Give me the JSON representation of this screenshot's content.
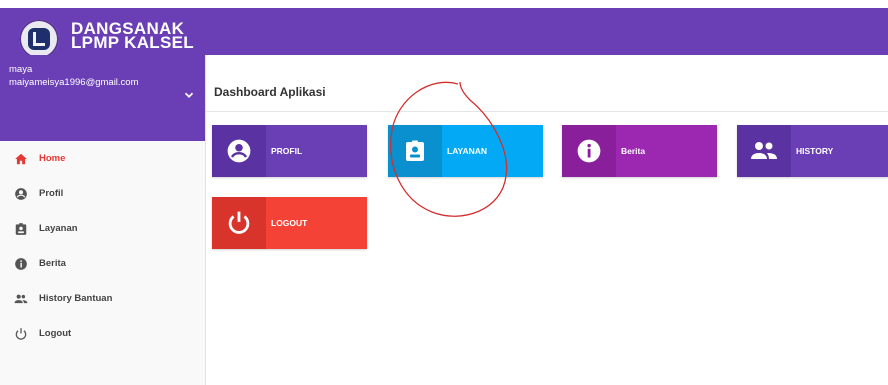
{
  "app": {
    "brand_line1": "DANGSANAK",
    "brand_line2": "LPMP KALSEL"
  },
  "user": {
    "name": "maya",
    "email": "maiyameisya1996@gmail.com"
  },
  "sidebar": {
    "items": [
      {
        "label": "Home",
        "icon": "home-icon",
        "active": true
      },
      {
        "label": "Profil",
        "icon": "account-circle-icon"
      },
      {
        "label": "Layanan",
        "icon": "assignment-ind-icon"
      },
      {
        "label": "Berita",
        "icon": "info-icon"
      },
      {
        "label": "History Bantuan",
        "icon": "people-icon"
      },
      {
        "label": "Logout",
        "icon": "power-icon"
      }
    ]
  },
  "main": {
    "title": "Dashboard Aplikasi",
    "tiles": [
      {
        "label": "PROFIL",
        "icon": "account-circle-icon",
        "color": "#6a3fb5",
        "icon_bg": "#5b32a1"
      },
      {
        "label": "LAYANAN",
        "icon": "assignment-ind-icon",
        "color": "#03a9f4",
        "icon_bg": "#0a8fcf"
      },
      {
        "label": "Berita",
        "icon": "info-icon",
        "color": "#9c27b0",
        "icon_bg": "#8a1f9c"
      },
      {
        "label": "HISTORY",
        "icon": "people-icon",
        "color": "#6a3fb5",
        "icon_bg": "#5b32a1"
      },
      {
        "label": "LOGOUT",
        "icon": "power-icon",
        "color": "#f44336",
        "icon_bg": "#d8342b"
      }
    ]
  },
  "colors": {
    "primary": "#6a3fb5",
    "active": "#e53935",
    "annotation": "#d32f2f"
  }
}
